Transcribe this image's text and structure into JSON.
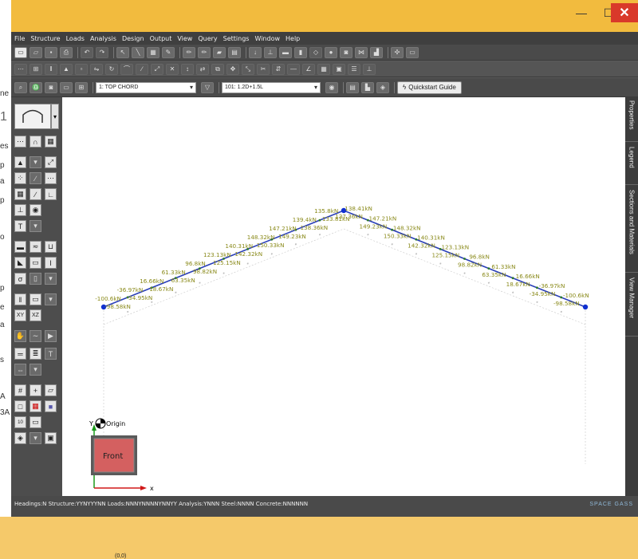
{
  "behind_window_text": [
    "ne",
    "1",
    "es",
    "p",
    "a",
    "p",
    "o",
    "p",
    "e",
    "a",
    "s",
    "A",
    "3A"
  ],
  "window": {
    "controls": {
      "minimize": "—",
      "maximize": "☐",
      "close": "✕"
    }
  },
  "menu": [
    "File",
    "Structure",
    "Loads",
    "Analysis",
    "Design",
    "Output",
    "View",
    "Query",
    "Settings",
    "Window",
    "Help"
  ],
  "toolbar3": {
    "member_group": "1: TOP CHORD",
    "load_combination": "101: 1.2D+1.5L",
    "quickstart_label": "Quickstart Guide"
  },
  "right_tabs": [
    "Properties",
    "Legend",
    "Sections and Materials",
    "View Manager"
  ],
  "viewport": {
    "origin_label": "Origin",
    "axis_y": "Y",
    "axis_x": "x",
    "view_cube_label": "Front",
    "coord_readout": "(0,0)",
    "member_color": "#2a3fb8",
    "label_color": "#8a8a1a",
    "node_color": "#1030d0"
  },
  "force_labels": {
    "left_upper": [
      "-100.6kN",
      "-36.97kN",
      "16.66kN",
      "61.33kN",
      "96.8kN",
      "123.13kN",
      "140.31kN",
      "148.32kN",
      "147.21kN",
      "139.4kN",
      "135.8kN"
    ],
    "left_lower": [
      "-98.58kN",
      "-34.95kN",
      "18.67kN",
      "63.35kN",
      "98.82kN",
      "125.15kN",
      "142.32kN",
      "150.33kN",
      "149.23kN",
      "138.36kN",
      "133.81kN"
    ],
    "right_upper": [
      "138.41kN",
      "147.21kN",
      "148.32kN",
      "140.31kN",
      "123.13kN",
      "96.8kN",
      "61.33kN",
      "16.66kN",
      "-36.97kN",
      "-100.6kN"
    ],
    "right_lower": [
      "137.36kN",
      "149.23kN",
      "150.33kN",
      "142.32kN",
      "125.15kN",
      "98.82kN",
      "63.35kN",
      "18.67kN",
      "-34.95kN",
      "-98.58kN"
    ]
  },
  "status": {
    "text": "Headings:N Structure:YYNYYYNN Loads:NNNYNNNNYNNYY Analysis:YNNN Steel:NNNN Concrete:NNNNNN",
    "brand": "SPACE GASS"
  }
}
